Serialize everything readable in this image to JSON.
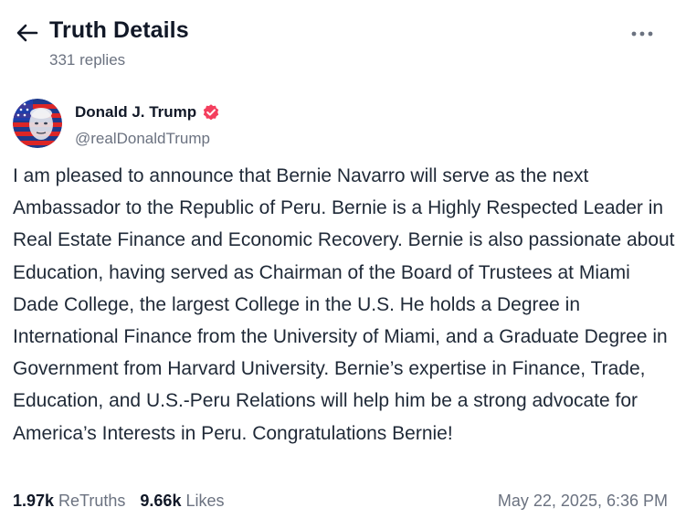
{
  "header": {
    "title": "Truth Details",
    "reply_count": "331 replies",
    "back_icon": "arrow-left-icon",
    "more_icon": "more-horizontal-icon"
  },
  "post": {
    "author": {
      "display_name": "Donald J. Trump",
      "handle": "@realDonaldTrump",
      "verified": true,
      "verified_color": "#f43f5e"
    },
    "body": "I am pleased to announce that Bernie Navarro will serve as the next Ambassador to the Republic of Peru. Bernie is a Highly Respected Leader in Real Estate Finance and Economic Recovery. Bernie is also passionate about Education, having served as Chairman of the Board of Trustees at Miami Dade College, the largest College in the U.S. He holds a Degree in International Finance from the University of Miami, and a Graduate Degree in Government from Harvard University. Bernie’s expertise in Finance, Trade, Education, and U.S.-Peru Relations will help him be a strong advocate for America’s Interests in Peru. Congratulations Bernie!",
    "stats": {
      "retruths_count": "1.97k",
      "retruths_label": "ReTruths",
      "likes_count": "9.66k",
      "likes_label": "Likes"
    },
    "timestamp": "May 22, 2025, 6:36 PM"
  }
}
